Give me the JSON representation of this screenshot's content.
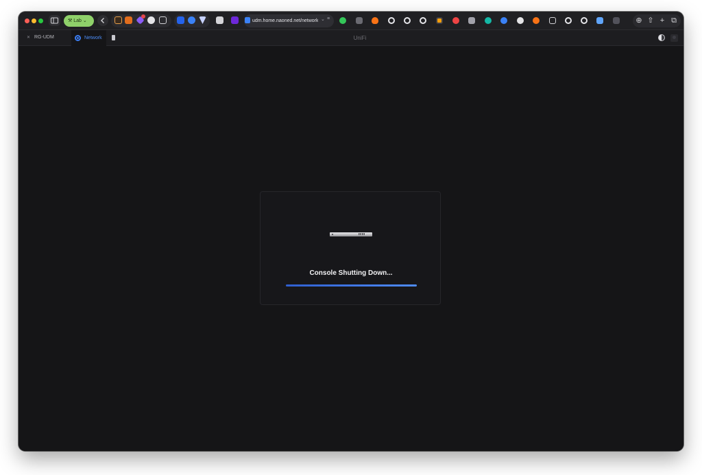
{
  "browser": {
    "profile_label": "Lab",
    "url": "udm.home.naoned.net/network/",
    "url_chevron": "⌄",
    "reader_icon": "≡"
  },
  "tabs": {
    "rg_label": "RG-UDM",
    "active_label": "Network"
  },
  "app": {
    "title": "UniFi"
  },
  "dialog": {
    "status_text": "Console Shutting Down...",
    "progress_fraction": 1.0,
    "device_name": "console-device-image"
  },
  "colors": {
    "accent": "#4d8df7",
    "background": "#151517",
    "profile_pill": "#8fd16a"
  },
  "toolbar_icons": [
    "bookmarks-icon",
    "shield-icon",
    "puzzle-icon",
    "paw-icon",
    "thumbs-down-icon",
    "bookmark-icon",
    "cloud-icon",
    "vuejs-icon",
    "grid-icon",
    "arc-icon",
    "download-icon",
    "share-icon",
    "new-tab-icon",
    "tabs-overview-icon"
  ]
}
